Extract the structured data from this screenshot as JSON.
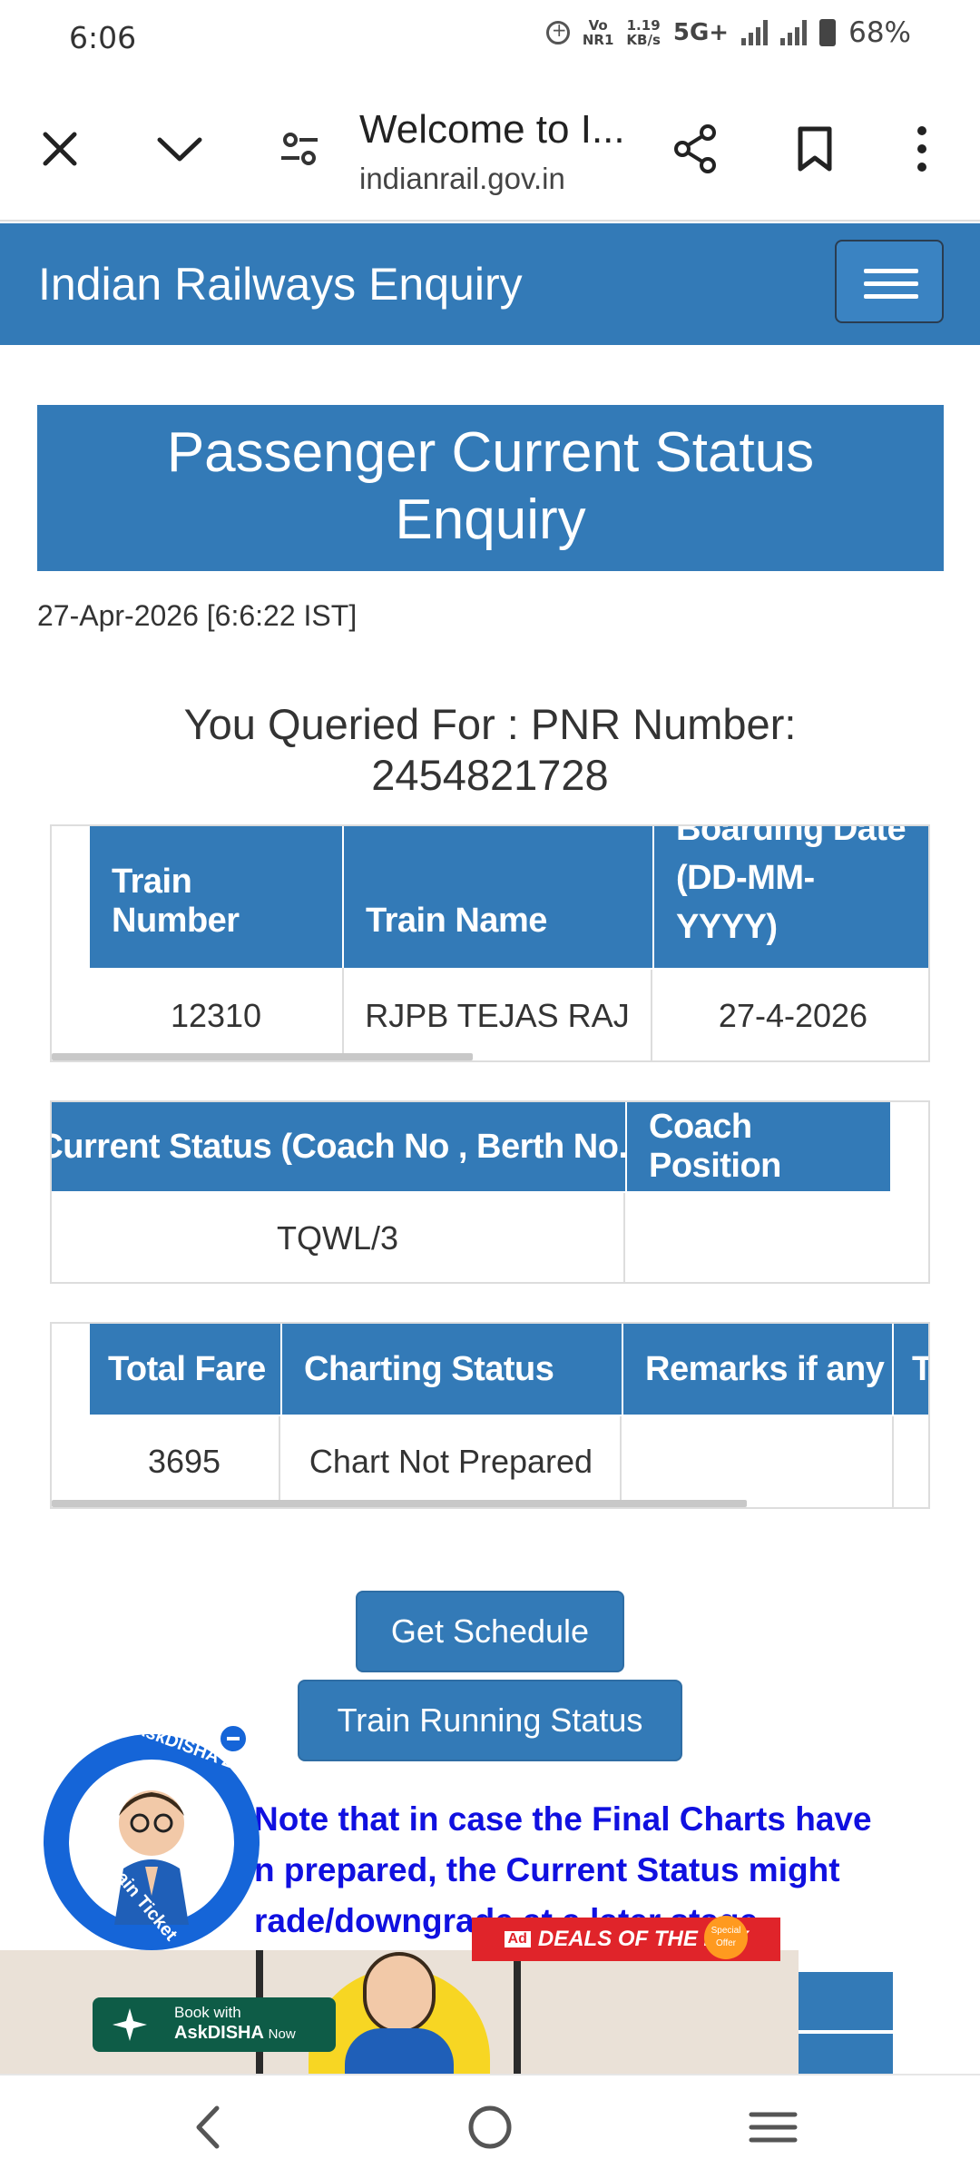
{
  "status_bar": {
    "time": "6:06",
    "volte": "Vo",
    "volte_sub": "NR1",
    "speed": "1.19",
    "speed_unit": "KB/s",
    "network": "5G+",
    "battery": "68%"
  },
  "browser": {
    "title": "Welcome to I...",
    "url": "indianrail.gov.in",
    "icons": [
      "close-icon",
      "chevron-down-icon",
      "tune-icon",
      "share-icon",
      "bookmark-icon",
      "more-vert-icon"
    ]
  },
  "site": {
    "brand": "Indian Railways Enquiry"
  },
  "page": {
    "heading_line1": "Passenger Current Status",
    "heading_line2": "Enquiry",
    "timestamp": "27-Apr-2026 [6:6:22 IST]",
    "queried_line1": "You Queried For : PNR Number:",
    "queried_line2": "2454821728"
  },
  "train_table": {
    "headers": [
      "Train Number",
      "Train Name",
      "Boarding Date",
      "(DD-MM-YYYY)"
    ],
    "row": [
      "12310",
      "RJPB TEJAS RAJ",
      "27-4-2026"
    ]
  },
  "status_table": {
    "headers": [
      "Current Status (Coach No , Berth No.)",
      "Coach Position"
    ],
    "row": [
      "TQWL/3",
      ""
    ]
  },
  "fare_table": {
    "headers": [
      "Total Fare",
      "Charting Status",
      "Remarks if any",
      "T"
    ],
    "row": [
      "3695",
      "Chart Not Prepared",
      "",
      ""
    ]
  },
  "buttons": {
    "schedule": "Get Schedule",
    "running_status": "Train Running Status"
  },
  "note": {
    "line1": "Note that in case the Final Charts have",
    "line2": "n prepared, the Current Status might",
    "line3": "rade/downgrade at a later stage."
  },
  "askdisha": {
    "top_text": "AskDISHA 2.0",
    "bottom_text": "Book Train Ticket"
  },
  "ad": {
    "badge": "Ad",
    "deals": "DEALS OF THE DAY",
    "special": "Special Offer",
    "book_line1": "Book with",
    "book_line2": "AskDISHA",
    "book_line3": "Now"
  },
  "colors": {
    "primary": "#337ab7",
    "note_text": "#1010e0",
    "askdisha": "#1565d8",
    "deals": "#e0242a"
  }
}
